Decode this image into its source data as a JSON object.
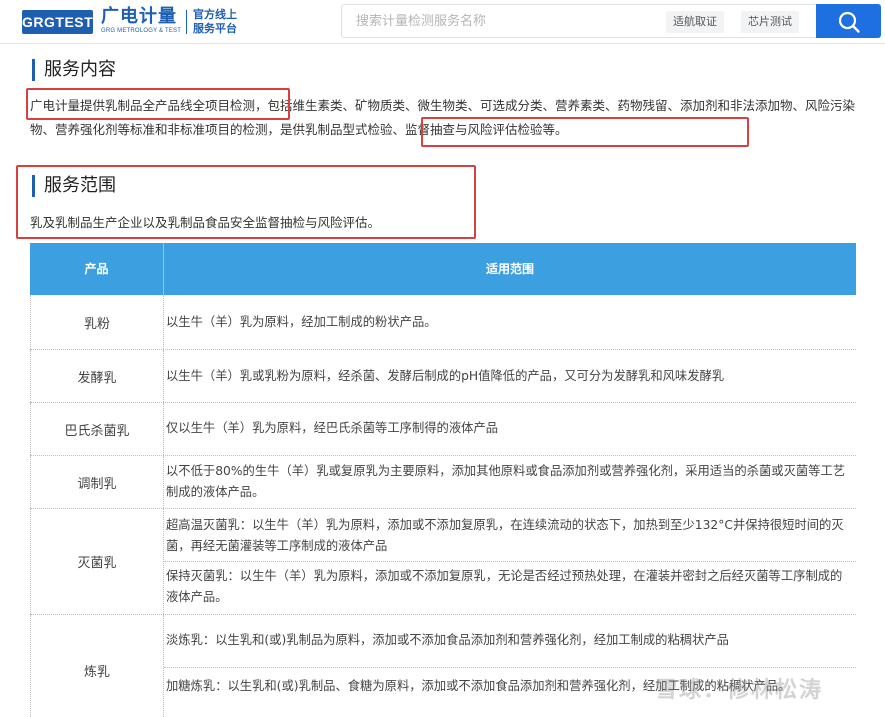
{
  "header": {
    "logo_text": "GRGTEST",
    "brand_cn": "广电计量",
    "brand_en": "GRG METROLOGY & TEST",
    "slogan_line1": "官方线上",
    "slogan_line2": "服务平台",
    "search_placeholder": "搜索计量检测服务名称",
    "search_tags": [
      "适航取证",
      "芯片测试"
    ],
    "search_icon": "search-icon",
    "accent_color": "#1e6fe0"
  },
  "service_content": {
    "title": "服务内容",
    "text_part1": "广电计量提供乳制品全产品线全项目检测",
    "text_part2": "，包括维生素类、矿物质类、微生物类、可选成分类、营养素类、药物残留、添加剂和非法添加物、风险污染物、营养强化剂等标准和非标准项目的检测，",
    "text_part3": "是供乳制品型式检验、监督抽查与风险评估检验等。"
  },
  "service_scope": {
    "title": "服务范围",
    "text": "乳及乳制品生产企业以及乳制品食品安全监督抽检与风险评估。"
  },
  "table": {
    "header_color": "#3c9fe0",
    "columns": [
      "产品",
      "适用范围"
    ],
    "rows": [
      {
        "product": "乳粉",
        "descriptions": [
          "以生牛（羊）乳为原料，经加工制成的粉状产品。"
        ]
      },
      {
        "product": "发酵乳",
        "descriptions": [
          "以生牛（羊）乳或乳粉为原料，经杀菌、发酵后制成的pH值降低的产品，又可分为发酵乳和风味发酵乳"
        ]
      },
      {
        "product": "巴氏杀菌乳",
        "descriptions": [
          "仅以生牛（羊）乳为原料，经巴氏杀菌等工序制得的液体产品"
        ]
      },
      {
        "product": "调制乳",
        "descriptions": [
          "以不低于80%的生牛（羊）乳或复原乳为主要原料，添加其他原料或食品添加剂或营养强化剂，采用适当的杀菌或灭菌等工艺制成的液体产品。"
        ]
      },
      {
        "product": "灭菌乳",
        "descriptions": [
          "超高温灭菌乳：以生牛（羊）乳为原料，添加或不添加复原乳，在连续流动的状态下，加热到至少132°C并保持很短时间的灭菌，再经无菌灌装等工序制成的液体产品",
          "保持灭菌乳：以生牛（羊）乳为原料，添加或不添加复原乳，无论是否经过预热处理，在灌装并密封之后经灭菌等工序制成的液体产品。"
        ]
      },
      {
        "product": "炼乳",
        "descriptions": [
          "淡炼乳：以生乳和(或)乳制品为原料，添加或不添加食品添加剂和营养强化剂，经加工制成的粘稠状产品",
          "加糖炼乳：以生乳和(或)乳制品、食糖为原料，添加或不添加食品添加剂和营养强化剂，经加工制成的粘稠状产品。"
        ]
      }
    ]
  },
  "watermark": "雪球：修林松涛"
}
